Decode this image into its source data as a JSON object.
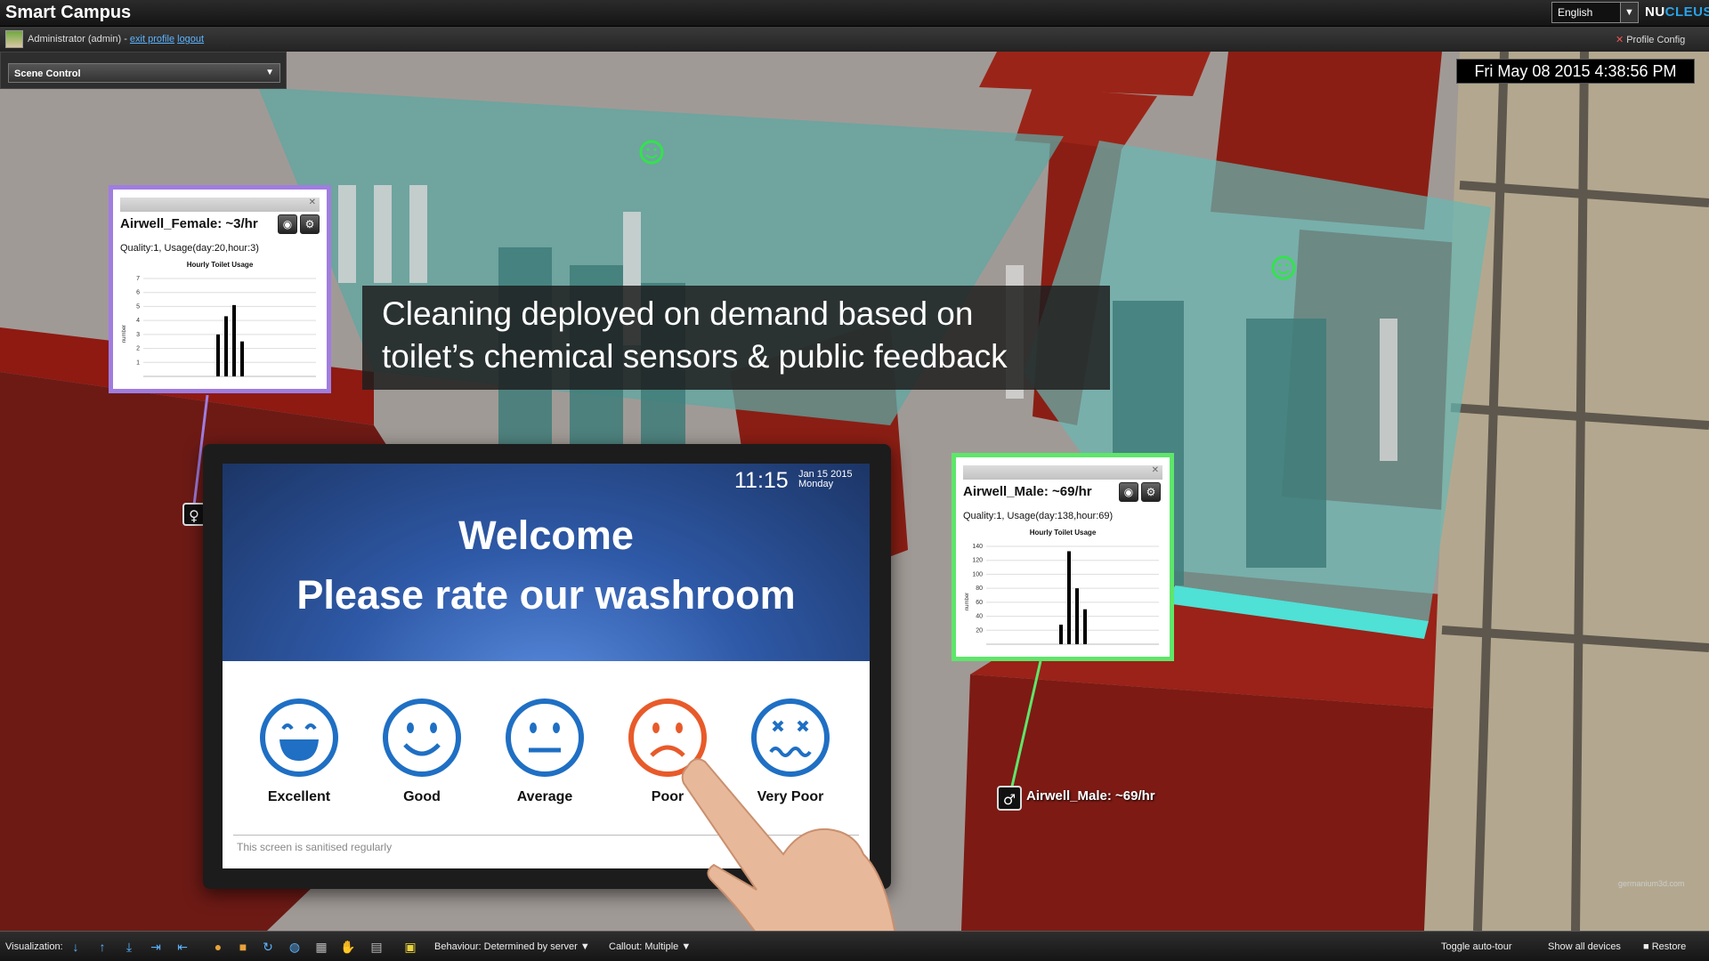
{
  "app": {
    "title": "Smart Campus",
    "brand_a": "NU",
    "brand_b": "CLEUS",
    "language": "English"
  },
  "user": {
    "name": "Administrator (admin) - ",
    "exit_profile": "exit profile",
    "logout": "logout",
    "profile_config": "Profile Config"
  },
  "scene_control": {
    "label": "Scene Control"
  },
  "clock": "Fri May 08 2015 4:38:56 PM",
  "banner": {
    "line1": "Cleaning deployed on demand based on",
    "line2": "toilet’s chemical sensors & public feedback"
  },
  "callouts": [
    {
      "title": "Airwell_Female: ~3/hr",
      "subtitle": "Quality:1, Usage(day:20,hour:3)",
      "chart_data": {
        "type": "bar",
        "title": "Hourly Toilet Usage",
        "ylabel": "number",
        "ylim": [
          0,
          7
        ],
        "yticks": [
          1,
          2,
          3,
          4,
          5,
          6,
          7
        ],
        "values": [
          3,
          4.3,
          5.1,
          2.5
        ]
      }
    },
    {
      "title": "Airwell_Male: ~69/hr",
      "subtitle": "Quality:1, Usage(day:138,hour:69)",
      "chart_data": {
        "type": "bar",
        "title": "Hourly Toilet Usage",
        "ylabel": "number",
        "ylim": [
          0,
          140
        ],
        "yticks": [
          20,
          40,
          60,
          80,
          100,
          120,
          140
        ],
        "values": [
          28,
          133,
          80,
          50
        ]
      }
    }
  ],
  "tablet": {
    "time": "11:15",
    "date": "Jan 15 2015",
    "day": "Monday",
    "welcome": "Welcome",
    "prompt": "Please rate our washroom",
    "ratings": [
      {
        "label": "Excellent",
        "icon": "excellent-face-icon",
        "color": "#1f6fc4"
      },
      {
        "label": "Good",
        "icon": "good-face-icon",
        "color": "#1f6fc4"
      },
      {
        "label": "Average",
        "icon": "average-face-icon",
        "color": "#1f6fc4"
      },
      {
        "label": "Poor",
        "icon": "poor-face-icon",
        "color": "#e85a2a"
      },
      {
        "label": "Very Poor",
        "icon": "very-poor-face-icon",
        "color": "#1f6fc4"
      }
    ],
    "footer": "This screen is sanitised regularly"
  },
  "scene_label": "Airwell_Male: ~69/hr",
  "bottom": {
    "visualization": "Visualization:",
    "behaviour": "Behaviour: Determined by server",
    "callout": "Callout: Multiple",
    "toggle_tour": "Toggle auto-tour",
    "show_devices": "Show all devices",
    "restore": "Restore"
  },
  "watermark": "germanium3d.com"
}
